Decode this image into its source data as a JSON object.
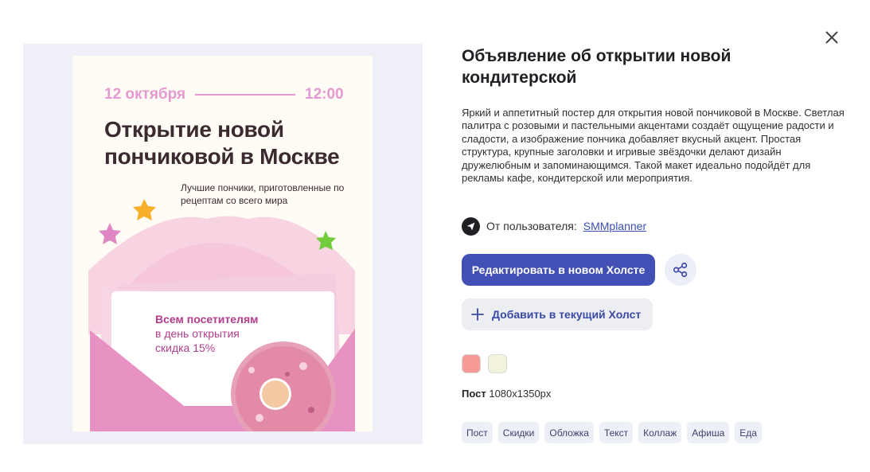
{
  "poster": {
    "date": "12 октября",
    "time": "12:00",
    "title": "Открытие новой пончиковой в Москве",
    "subtitle": "Лучшие пончики, приготовленные по рецептам со всего мира",
    "card_headline": "Всем посетителям",
    "card_line1": "в день открытия",
    "card_line2": "скидка 15%"
  },
  "template": {
    "title": "Объявление об открытии новой кондитерской",
    "description": "Яркий и аппетитный постер для открытия новой пончиковой в Москве. Светлая палитра с розовыми и пастельными акцентами создаёт ощущение радости и сладости, а изображение пончика добавляет вкусный акцент. Простая структура, крупные заголовки и игривые звёздочки делают дизайн дружелюбным и запоминающимся. Такой макет идеально подойдёт для рекламы кафе, кондитерской или мероприятия.",
    "author_prefix": "От пользователя:",
    "author_name": "SMMplanner",
    "edit_label": "Редактировать в новом Холсте",
    "add_label": "Добавить в текущий Холст",
    "format_label": "Пост",
    "format_size": "1080x1350px"
  },
  "colors": {
    "accent": "#4250b6",
    "swatches": [
      "#f79a98",
      "#f3f3dc"
    ]
  },
  "tags": [
    "Пост",
    "Скидки",
    "Обложка",
    "Текст",
    "Коллаж",
    "Афиша",
    "Еда"
  ],
  "icons": [
    "close-icon",
    "telegram-icon",
    "share-icon",
    "plus-icon"
  ]
}
